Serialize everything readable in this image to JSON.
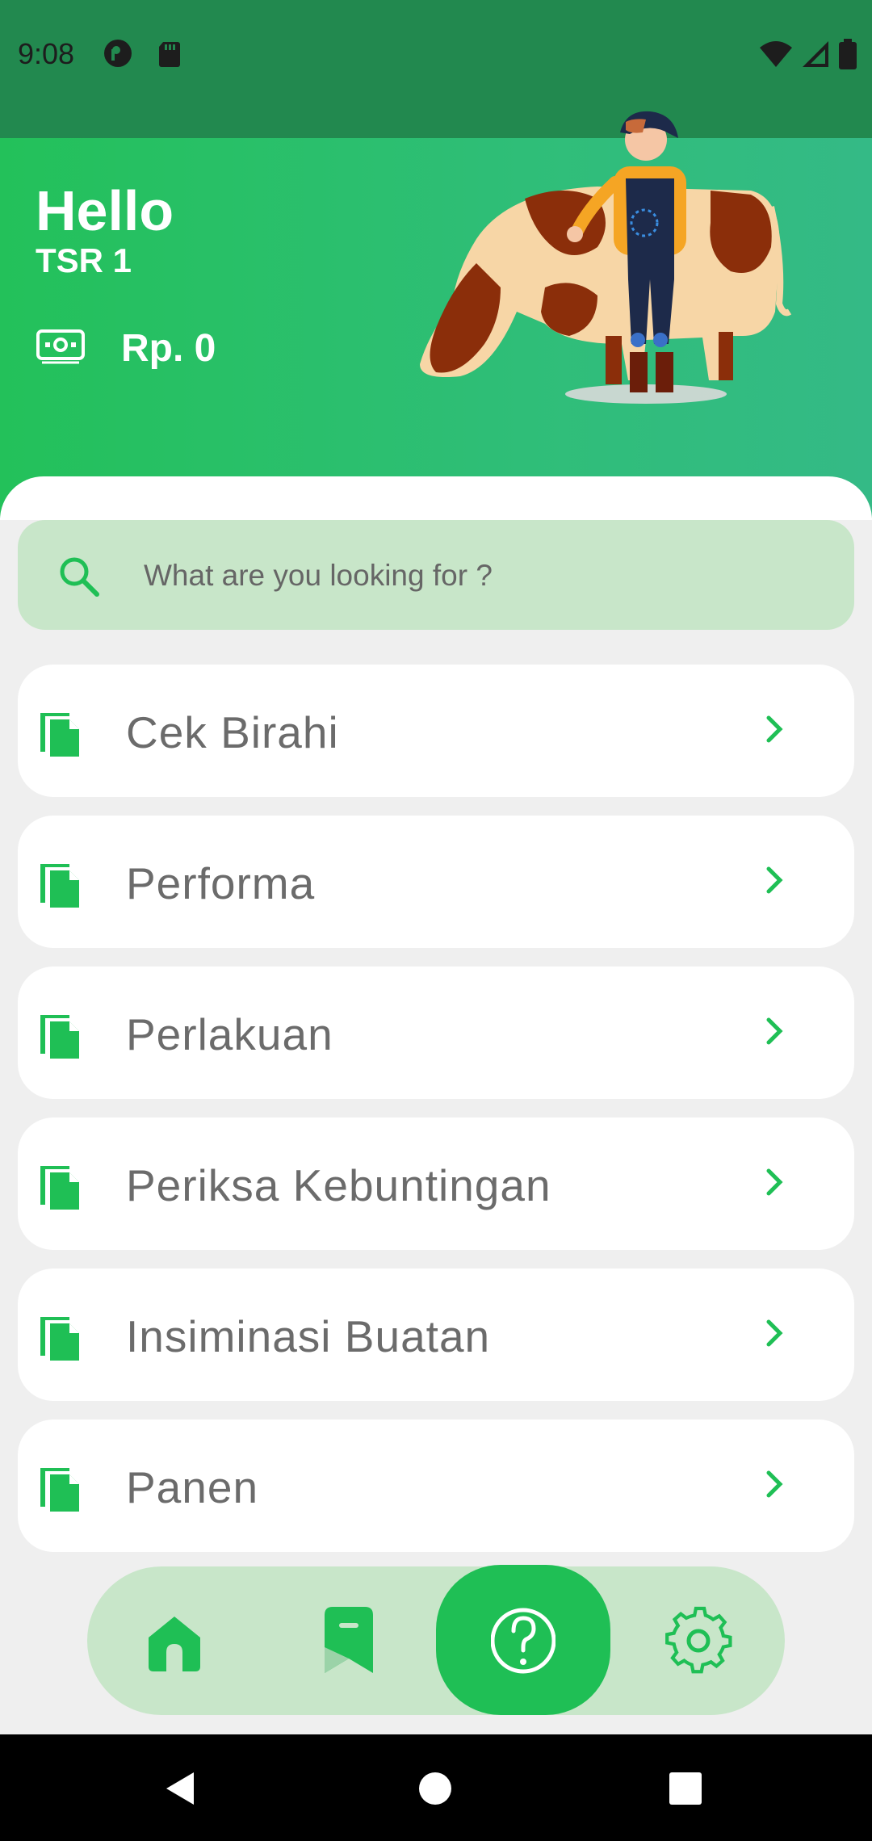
{
  "status_bar": {
    "time": "9:08"
  },
  "header": {
    "greeting": "Hello",
    "user_name": "TSR 1",
    "balance": "Rp. 0"
  },
  "search": {
    "placeholder": "What are you looking for ?"
  },
  "menu": {
    "items": [
      {
        "label": "Cek Birahi"
      },
      {
        "label": "Performa"
      },
      {
        "label": "Perlakuan"
      },
      {
        "label": "Periksa Kebuntingan"
      },
      {
        "label": "Insiminasi Buatan"
      },
      {
        "label": "Panen"
      }
    ]
  },
  "bottom_nav": {
    "items": [
      "home-icon",
      "bookmark-icon",
      "help-icon",
      "settings-icon"
    ],
    "active": "help-icon"
  },
  "colors": {
    "primary": "#1fbf55",
    "light_green": "#c8e6c9",
    "status_bar": "#22894f"
  }
}
